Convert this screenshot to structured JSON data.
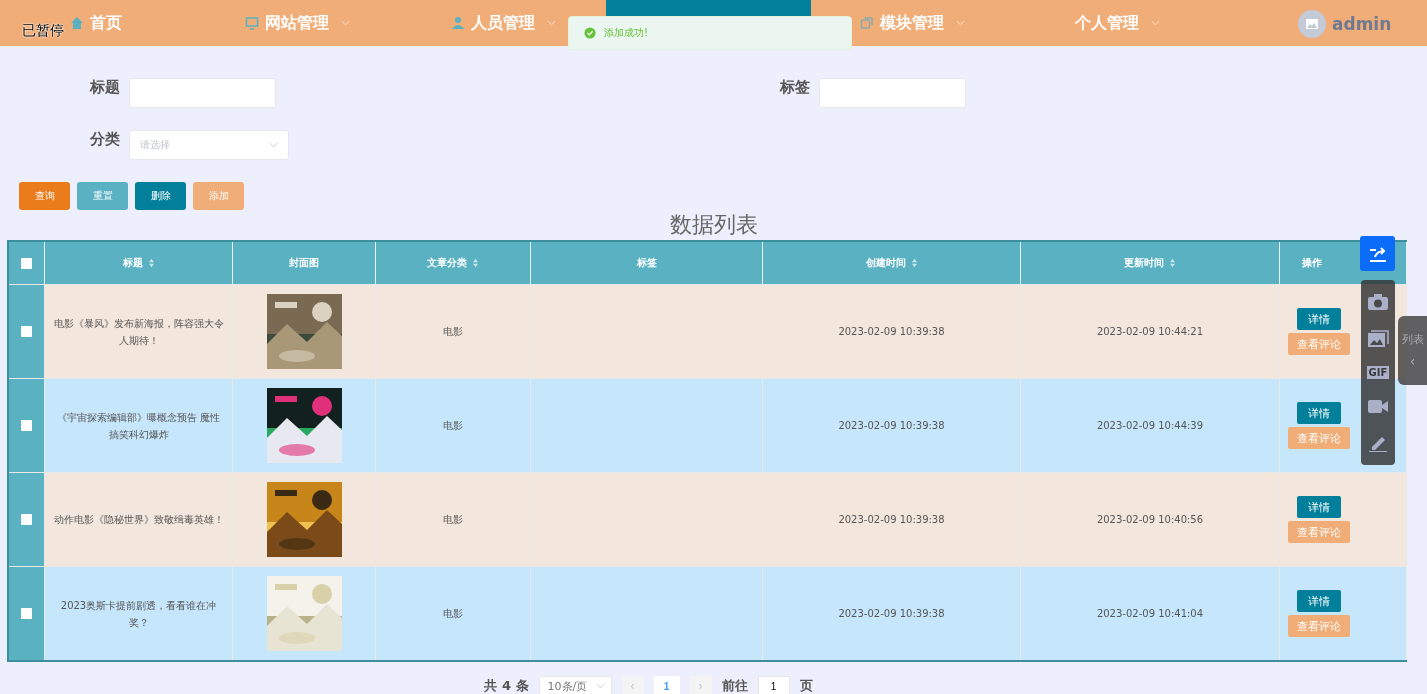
{
  "overlay_label": "已暂停",
  "nav": [
    {
      "label": "首页",
      "dropdown": false
    },
    {
      "label": "网站管理",
      "dropdown": true
    },
    {
      "label": "人员管理",
      "dropdown": true
    },
    {
      "label": "模块管理",
      "dropdown": true
    },
    {
      "label": "个人管理",
      "dropdown": true
    }
  ],
  "user": {
    "name": "admin"
  },
  "toast": {
    "message": "添加成功!"
  },
  "filters": {
    "title_label": "标题",
    "tag_label": "标签",
    "category_label": "分类",
    "category_placeholder": "请选择"
  },
  "actions": [
    {
      "label": "查询",
      "kind": "search"
    },
    {
      "label": "重置",
      "kind": "reset"
    },
    {
      "label": "删除",
      "kind": "delete"
    },
    {
      "label": "添加",
      "kind": "add"
    }
  ],
  "table": {
    "title": "数据列表",
    "all_checked": false,
    "columns": [
      {
        "label": "标题",
        "sortable": true
      },
      {
        "label": "封面图",
        "sortable": false
      },
      {
        "label": "文章分类",
        "sortable": true
      },
      {
        "label": "标签",
        "sortable": false
      },
      {
        "label": "创建时间",
        "sortable": true
      },
      {
        "label": "更新时间",
        "sortable": true
      },
      {
        "label": "操作",
        "sortable": false
      }
    ],
    "rows": [
      {
        "checked": false,
        "title": "电影《暴风》发布新海报，阵容强大令人期待！",
        "category": "电影",
        "created": "2023-02-09 10:39:38",
        "updated": "2023-02-09 10:44:21",
        "detail": "详情",
        "comments": "查看评论"
      },
      {
        "checked": false,
        "title": "《宇宙探索编辑部》曝概念预告 魔性搞笑科幻爆炸",
        "category": "电影",
        "created": "2023-02-09 10:39:38",
        "updated": "2023-02-09 10:44:39",
        "detail": "详情",
        "comments": "查看评论"
      },
      {
        "checked": false,
        "title": "动作电影《隐秘世界》致敬缉毒英雄！",
        "category": "电影",
        "created": "2023-02-09 10:39:38",
        "updated": "2023-02-09 10:40:56",
        "detail": "详情",
        "comments": "查看评论"
      },
      {
        "checked": false,
        "title": "2023奥斯卡提前剧透，看看谁在冲奖？",
        "category": "电影",
        "created": "2023-02-09 10:39:38",
        "updated": "2023-02-09 10:41:04",
        "detail": "详情",
        "comments": "查看评论"
      }
    ]
  },
  "pagination": {
    "total": "共 4 条",
    "page_size": "10条/页",
    "prev": "‹",
    "pages": [
      {
        "label": "1",
        "selected": true
      }
    ],
    "next": "›",
    "goto_label": "前往",
    "goto_value": "1",
    "goto_suffix": "页"
  },
  "capture_toolbar": {
    "gif": "GIF"
  },
  "side_tab": {
    "label": "列表",
    "arrow": "‹"
  }
}
